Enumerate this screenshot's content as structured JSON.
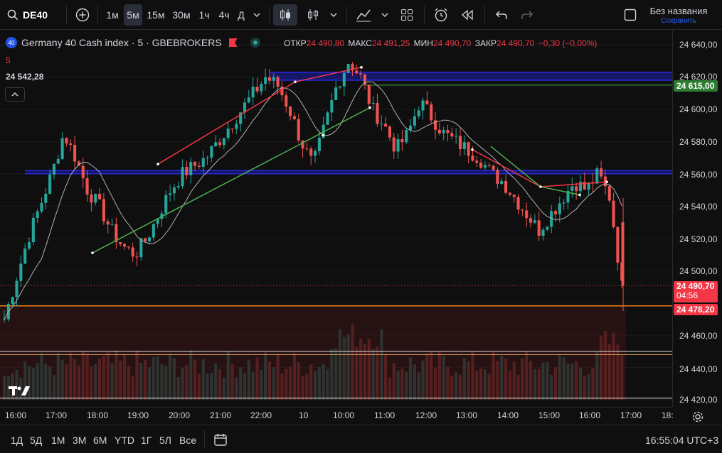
{
  "toolbar": {
    "symbol": "DE40",
    "intervals": [
      "1м",
      "5м",
      "15м",
      "30м",
      "1ч",
      "4ч",
      "Д"
    ],
    "active_interval": "5м",
    "layout_name": "Без названия",
    "save_label": "Сохранить"
  },
  "legend": {
    "badge": "40",
    "title": "Germany 40 Cash index · 5 · GBEBROKERS",
    "interval_sub": "5",
    "last_value": "24 542,28",
    "open_label": "ОТКР",
    "open": "24 490,80",
    "high_label": "МАКС",
    "high": "24 491,25",
    "low_label": "МИН",
    "low": "24 490,70",
    "close_label": "ЗАКР",
    "close": "24 490,70",
    "change": "−0,30 (−0,00%)"
  },
  "y_axis": {
    "ticks": [
      "24 640,00",
      "24 620,00",
      "24 600,00",
      "24 580,00",
      "24 560,00",
      "24 540,00",
      "24 520,00",
      "24 500,00",
      "24 460,00",
      "24 440,00",
      "24 420,00"
    ],
    "tag_green": "24 615,00",
    "tag_price": "24 490,70",
    "tag_timer": "04:56",
    "tag_red": "24 478,20"
  },
  "x_axis": {
    "ticks": [
      "16:00",
      "17:00",
      "18:00",
      "19:00",
      "20:00",
      "21:00",
      "22:00",
      "10",
      "10:00",
      "11:00",
      "12:00",
      "13:00",
      "14:00",
      "15:00",
      "16:00",
      "17:00",
      "18:"
    ]
  },
  "bottom": {
    "ranges": [
      "1Д",
      "5Д",
      "1М",
      "3М",
      "6М",
      "YTD",
      "1Г",
      "5Л",
      "Все"
    ],
    "clock": "16:55:04 UTC+3"
  },
  "colors": {
    "up": "#26a69a",
    "down": "#ef5350",
    "background": "#0f0f0f",
    "zone_blue": "#2e2eff",
    "green_line": "#4caf50",
    "red_line": "#f23645"
  },
  "chart_data": {
    "type": "candlestick",
    "instrument": "Germany 40 Cash index",
    "timeframe": "5",
    "ylim": [
      24410,
      24650
    ],
    "series": [
      {
        "name": "DE40",
        "values": [
          24470,
          24495,
          24520,
          24540,
          24560,
          24585,
          24570,
          24550,
          24540,
          24525,
          24515,
          24510,
          24520,
          24535,
          24550,
          24560,
          24565,
          24570,
          24580,
          24590,
          24600,
          24610,
          24620,
          24615,
          24600,
          24580,
          24565,
          24590,
          24615,
          24630,
          24620,
          24600,
          24590,
          24575,
          24585,
          24605,
          24595,
          24585,
          24580,
          24575,
          24570,
          24560,
          24555,
          24545,
          24535,
          24525,
          24535,
          24545,
          24555,
          24550,
          24560,
          24545,
          24490
        ]
      }
    ]
  }
}
